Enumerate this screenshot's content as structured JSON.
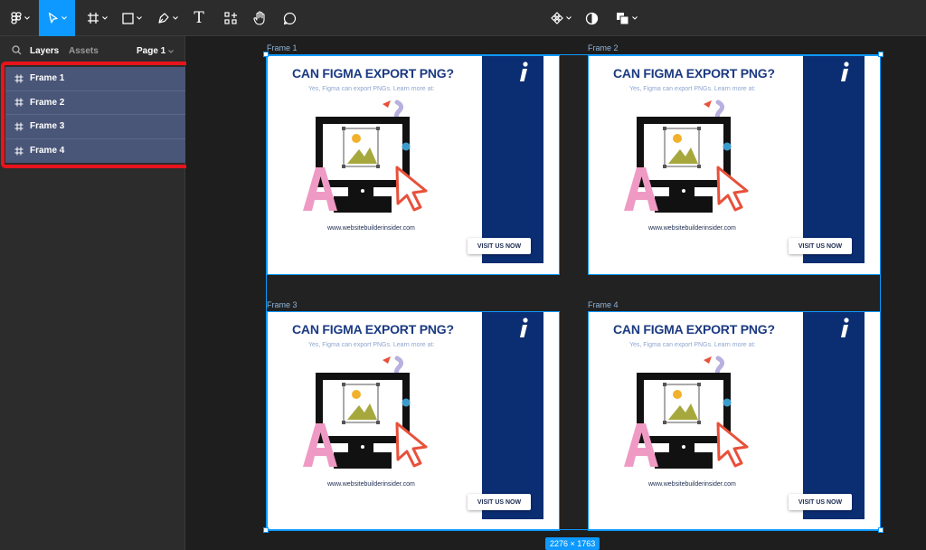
{
  "toolbar": {
    "tools": [
      {
        "name": "main-menu",
        "icon": "figma-logo-icon"
      },
      {
        "name": "move",
        "icon": "cursor-icon"
      },
      {
        "name": "frame",
        "icon": "frame-hash-icon"
      },
      {
        "name": "shape",
        "icon": "rectangle-icon"
      },
      {
        "name": "pen",
        "icon": "pen-icon"
      },
      {
        "name": "text",
        "icon": "text-icon",
        "glyph": "T"
      },
      {
        "name": "resources",
        "icon": "components-icon"
      },
      {
        "name": "hand",
        "icon": "hand-icon"
      },
      {
        "name": "comment",
        "icon": "comment-icon"
      },
      {
        "name": "create-component",
        "icon": "component-icon"
      },
      {
        "name": "mask",
        "icon": "mask-icon"
      },
      {
        "name": "boolean",
        "icon": "boolean-icon"
      }
    ]
  },
  "panel": {
    "tabs": {
      "layers": "Layers",
      "assets": "Assets"
    },
    "page": "Page 1",
    "layers": [
      {
        "label": "Frame 1"
      },
      {
        "label": "Frame 2"
      },
      {
        "label": "Frame 3"
      },
      {
        "label": "Frame 4"
      }
    ]
  },
  "canvas": {
    "frames": [
      {
        "label": "Frame 1"
      },
      {
        "label": "Frame 2"
      },
      {
        "label": "Frame 3"
      },
      {
        "label": "Frame 4"
      }
    ],
    "frame_content": {
      "title": "CAN FIGMA EXPORT PNG?",
      "subtitle": "Yes, Figma can export PNGs. Learn more at:",
      "url": "www.websitebuilderinsider.com",
      "button": "VISIT US NOW",
      "info_glyph": "i"
    },
    "selection_size": "2276 × 1763"
  },
  "colors": {
    "accent": "#0d99ff",
    "highlight": "#e8141b",
    "brand_navy": "#0b2d72",
    "layer_selected": "#4a5678"
  }
}
